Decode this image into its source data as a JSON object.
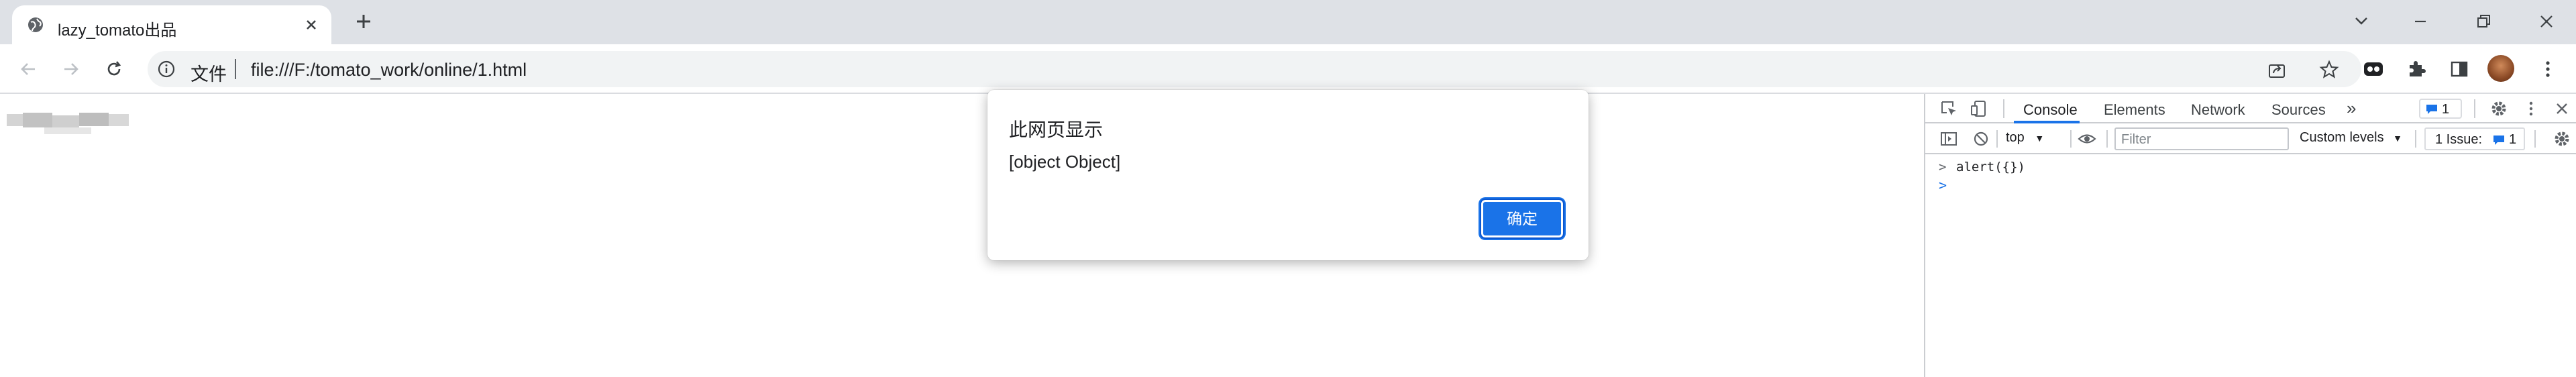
{
  "window": {
    "tab_title": "lazy_tomato出品",
    "controls": [
      "chevron-down-icon",
      "minimize-icon",
      "restore-icon",
      "close-icon"
    ]
  },
  "toolbar": {
    "url_scheme_label": "文件",
    "url": "file:///F:/tomato_work/online/1.html"
  },
  "dialog": {
    "title": "此网页显示",
    "message": "[object Object]",
    "ok_label": "确定"
  },
  "devtools": {
    "tabs": [
      "Console",
      "Elements",
      "Network",
      "Sources"
    ],
    "active_tab": "Console",
    "more_tabs": "»",
    "issue_count": "1",
    "context": "top",
    "filter_placeholder": "Filter",
    "levels_label": "Custom levels",
    "issues_label": "1 Issue:",
    "issues_count": "1",
    "console_lines": [
      {
        "prompt": ">",
        "text": "alert({})"
      },
      {
        "prompt": ">",
        "text": ""
      }
    ]
  },
  "colors": {
    "accent": "#1a73e8",
    "tabstrip_bg": "#dee1e6",
    "omnibox_bg": "#f1f3f4"
  }
}
